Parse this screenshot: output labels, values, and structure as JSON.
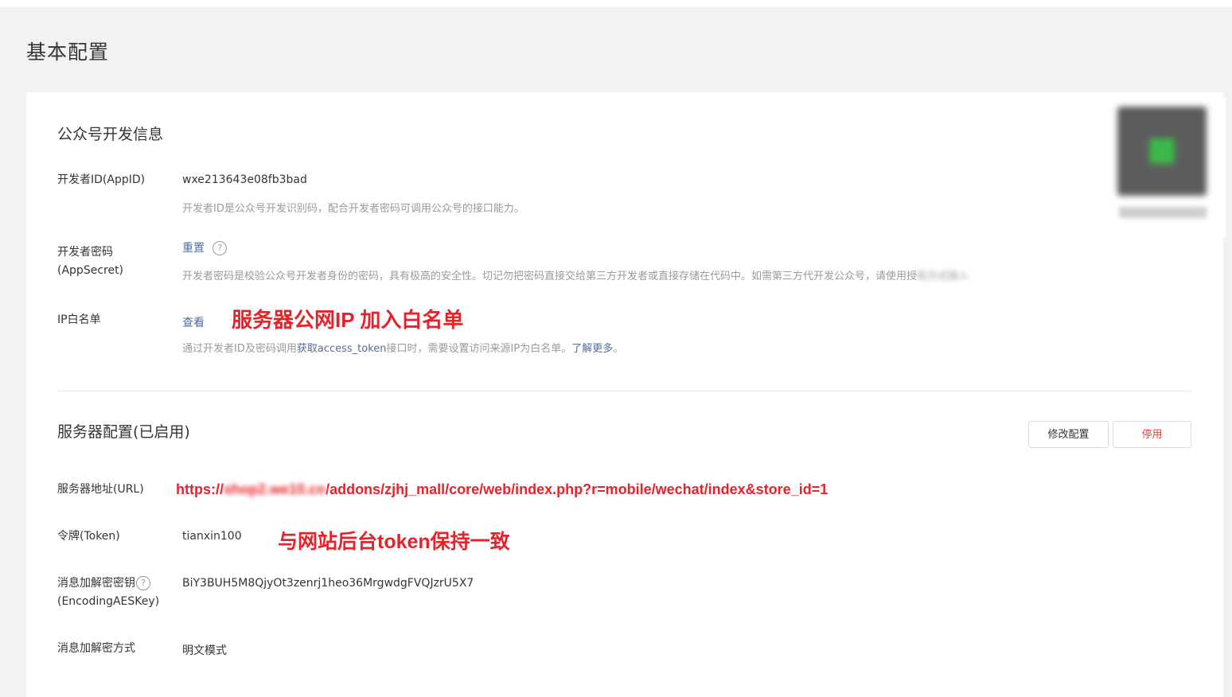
{
  "page": {
    "title": "基本配置"
  },
  "dev_info": {
    "title": "公众号开发信息",
    "appid": {
      "label": "开发者ID(AppID)",
      "value": "wxe213643e08fb3bad",
      "desc": "开发者ID是公众号开发识别码，配合开发者密码可调用公众号的接口能力。"
    },
    "secret": {
      "label_line1": "开发者密码",
      "label_line2": "(AppSecret)",
      "reset": "重置",
      "help": "?",
      "desc": "开发者密码是校验公众号开发者身份的密码，具有极高的安全性。切记勿把密码直接交给第三方开发者或直接存储在代码中。如需第三方代开发公众号，请使用授",
      "desc_blurred": "权方式接入"
    },
    "ip_whitelist": {
      "label": "IP白名单",
      "view": "查看",
      "desc_before": "通过开发者ID及密码调用",
      "desc_link": "获取access_token",
      "desc_middle": "接口时，需要设置访问来源IP为白名单。",
      "desc_more": "了解更多",
      "desc_end": "。"
    }
  },
  "server_config": {
    "title": "服务器配置(已启用)",
    "modify_button": "修改配置",
    "disable_button": "停用",
    "url": {
      "label": "服务器地址(URL)",
      "value_start": "https://",
      "value_blurred": "shop2.we10.cn",
      "value_end": "/addons/zjhj_mall/core/web/index.php?r=mobile/wechat/index&store_id=1"
    },
    "token": {
      "label": "令牌(Token)",
      "value": "tianxin100"
    },
    "aes_key": {
      "label_line1": "消息加解密密钥",
      "label_line2": "(EncodingAESKey)",
      "help": "?",
      "value": "BiY3BUH5M8QjyOt3zenrj1heo36MrgwdgFVQJzrU5X7"
    },
    "encrypt_mode": {
      "label": "消息加解密方式",
      "value": "明文模式"
    }
  },
  "annotations": {
    "ip_note": "服务器公网IP 加入白名单",
    "token_note": "与网站后台token保持一致"
  },
  "colors": {
    "link": "#576b95",
    "danger": "#e64340",
    "annotation": "#e8222a",
    "muted_text": "#9a9a9a",
    "background": "#f2f2f2"
  }
}
